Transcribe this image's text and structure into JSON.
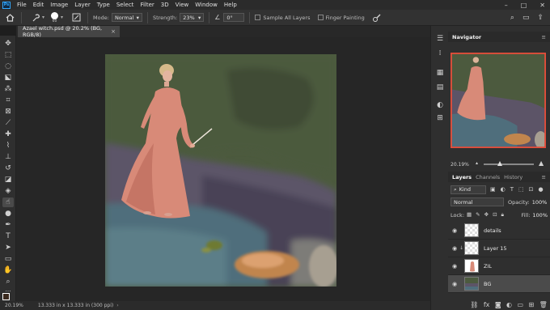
{
  "app": {
    "logo": "Ps",
    "menus": [
      "File",
      "Edit",
      "Image",
      "Layer",
      "Type",
      "Select",
      "Filter",
      "3D",
      "View",
      "Window",
      "Help"
    ]
  },
  "window_controls": [
    "–",
    "□",
    "✕"
  ],
  "options": {
    "mode_label": "Mode:",
    "mode_value": "Normal",
    "strength_label": "Strength:",
    "strength_value": "23%",
    "angle_value": "0°",
    "sample_all": "Sample All Layers",
    "finger_painting": "Finger Painting",
    "brush_size": "60"
  },
  "document_tab": {
    "title": "Azael witch.psd @ 20.2% (BG, RGB/8)",
    "close": "×"
  },
  "status": {
    "zoom": "20.19%",
    "doc_size": "13.333 in x 13.333 in (300 ppi)"
  },
  "navigator": {
    "title": "Navigator",
    "zoom": "20.19%"
  },
  "layers_panel": {
    "tabs": [
      "Layers",
      "Channels",
      "History"
    ],
    "kind_label": "Kind",
    "blend_mode": "Normal",
    "opacity_label": "Opacity:",
    "opacity_value": "100%",
    "lock_label": "Lock:",
    "fill_label": "Fill:",
    "fill_value": "100%",
    "layers": [
      {
        "name": "details",
        "visible": true
      },
      {
        "name": "Layer 15",
        "visible": true
      },
      {
        "name": "ZIL",
        "visible": true
      },
      {
        "name": "BG",
        "visible": true,
        "selected": true
      }
    ]
  },
  "colors": {
    "accent": "#31a8ff",
    "panel_bg": "#2f2f2f",
    "selected_layer": "#4b4b4b"
  }
}
